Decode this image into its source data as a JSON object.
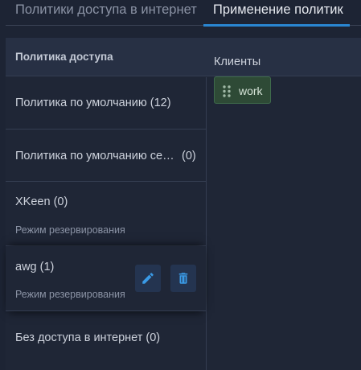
{
  "tabs": [
    {
      "label": "Политики доступа в интернет",
      "active": false
    },
    {
      "label": "Применение политик",
      "active": true
    }
  ],
  "panel": {
    "header_title": "Политика доступа"
  },
  "policies": [
    {
      "name": "Политика по умолчанию (12)",
      "count": "",
      "mode": ""
    },
    {
      "name": "Политика по умолчанию сегмента",
      "count": "(0)",
      "mode": ""
    },
    {
      "name": "XKeen (0)",
      "count": "",
      "mode": "Режим резервирования"
    },
    {
      "name": "awg (1)",
      "count": "",
      "mode": "Режим резервирования"
    },
    {
      "name": "Без доступа в интернет (0)",
      "count": "",
      "mode": ""
    }
  ],
  "clients": {
    "label": "Клиенты",
    "items": [
      {
        "name": "work"
      }
    ]
  },
  "icons": {
    "edit": "pencil-icon",
    "delete": "trash-icon",
    "drag": "drag-handle-icon"
  },
  "colors": {
    "accent": "#2a86d1",
    "background": "#1d2434",
    "chip_background": "#2e4a36"
  }
}
